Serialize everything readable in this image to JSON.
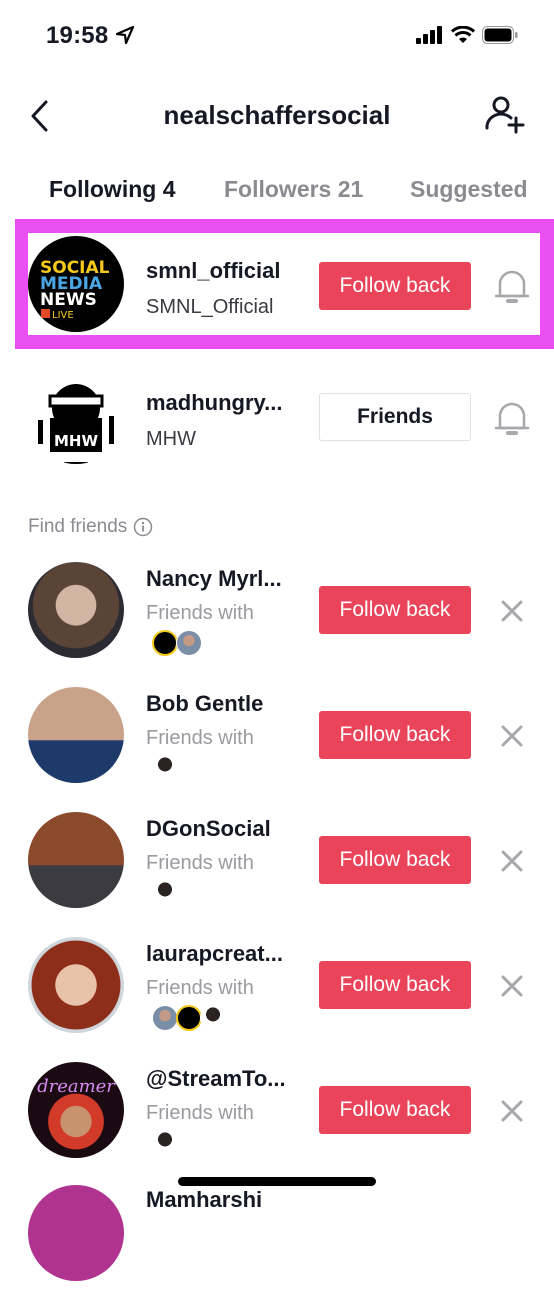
{
  "status_bar": {
    "time": "19:58",
    "icons": [
      "location-arrow-icon",
      "cellular-signal-icon",
      "wifi-icon",
      "battery-icon"
    ]
  },
  "header": {
    "title": "nealschaffersocial",
    "back_icon": "chevron-left-icon",
    "action_icon": "add-user-icon"
  },
  "tabs": [
    {
      "label": "Following 4",
      "active": true
    },
    {
      "label": "Followers 21",
      "active": false
    },
    {
      "label": "Suggested",
      "active": false
    }
  ],
  "following": [
    {
      "username": "smnl_official",
      "display_name": "SMNL_Official",
      "button": "Follow back",
      "button_style": "primary",
      "highlighted": true,
      "avatar_text": [
        "SOCIAL",
        "MEDIA",
        "NEWS",
        "LIVE"
      ]
    },
    {
      "username": "madhungry...",
      "display_name": "MHW",
      "button": "Friends",
      "button_style": "secondary",
      "highlighted": false,
      "avatar_text": [
        "MHW"
      ]
    }
  ],
  "find_friends": {
    "label": "Find friends",
    "subtitle": "Friends with",
    "button": "Follow back",
    "items": [
      {
        "username": "Nancy Myrl...",
        "mutuals": [
          "smnl",
          "man"
        ]
      },
      {
        "username": "Bob Gentle",
        "mutuals": [
          "woman"
        ]
      },
      {
        "username": "DGonSocial",
        "mutuals": [
          "woman"
        ]
      },
      {
        "username": "laurapcreat...",
        "mutuals": [
          "man",
          "smnl",
          "woman"
        ]
      },
      {
        "username": "@StreamTo...",
        "mutuals": [
          "woman"
        ],
        "avatar_text": "dreamer"
      },
      {
        "username": "Mamharshi",
        "mutuals": []
      }
    ]
  },
  "colors": {
    "primary": "#ea445a",
    "highlight": "#ea4ff3",
    "text": "#161823",
    "muted": "#8a8b91"
  }
}
